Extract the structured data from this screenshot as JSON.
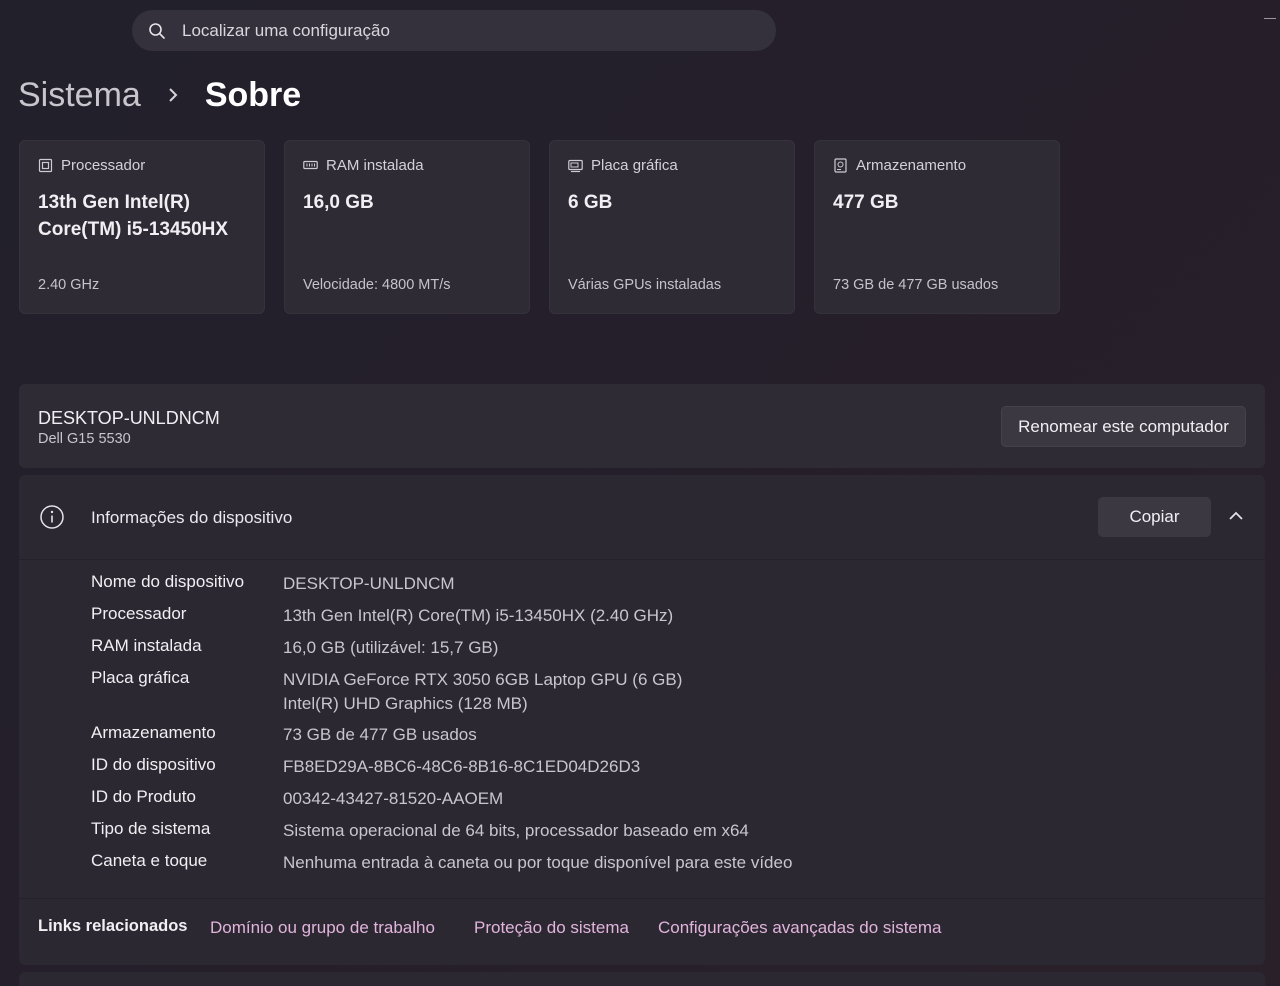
{
  "search": {
    "placeholder": "Localizar uma configuração"
  },
  "breadcrumb": {
    "parent": "Sistema",
    "current": "Sobre"
  },
  "cards": [
    {
      "icon": "processor-icon",
      "label": "Processador",
      "value": "13th Gen Intel(R) Core(TM) i5-13450HX",
      "sub": "2.40 GHz"
    },
    {
      "icon": "ram-icon",
      "label": "RAM instalada",
      "value": "16,0 GB",
      "sub": "Velocidade: 4800 MT/s"
    },
    {
      "icon": "gpu-icon",
      "label": "Placa gráfica",
      "value": "6 GB",
      "sub": "Várias GPUs instaladas"
    },
    {
      "icon": "storage-icon",
      "label": "Armazenamento",
      "value": "477 GB",
      "sub": "73 GB de 477 GB usados"
    }
  ],
  "device": {
    "name": "DESKTOP-UNLDNCM",
    "model": "Dell G15 5530",
    "rename_label": "Renomear este computador"
  },
  "info": {
    "title": "Informações do dispositivo",
    "copy_label": "Copiar",
    "rows": [
      {
        "label": "Nome do dispositivo",
        "value": "DESKTOP-UNLDNCM"
      },
      {
        "label": "Processador",
        "value": "13th Gen Intel(R) Core(TM) i5-13450HX (2.40 GHz)"
      },
      {
        "label": "RAM instalada",
        "value": "16,0 GB (utilizável: 15,7 GB)"
      },
      {
        "label": "Placa gráfica",
        "value": "NVIDIA GeForce RTX 3050 6GB Laptop GPU (6 GB)",
        "value2": "Intel(R) UHD Graphics (128 MB)"
      },
      {
        "label": "Armazenamento",
        "value": "73 GB de 477 GB usados"
      },
      {
        "label": "ID do dispositivo",
        "value": "FB8ED29A-8BC6-48C6-8B16-8C1ED04D26D3"
      },
      {
        "label": "ID do Produto",
        "value": "00342-43427-81520-AAOEM"
      },
      {
        "label": "Tipo de sistema",
        "value": "Sistema operacional de 64 bits, processador baseado em x64"
      },
      {
        "label": "Caneta e toque",
        "value": "Nenhuma entrada à caneta ou por toque disponível para este vídeo"
      }
    ]
  },
  "links": {
    "title": "Links relacionados",
    "items": [
      "Domínio ou grupo de trabalho",
      "Proteção do sistema",
      "Configurações avançadas do sistema"
    ]
  },
  "colors": {
    "accent_link": "#e2b4dc",
    "card_bg": "#2e2b35",
    "panel_bg": "#2b2832"
  }
}
